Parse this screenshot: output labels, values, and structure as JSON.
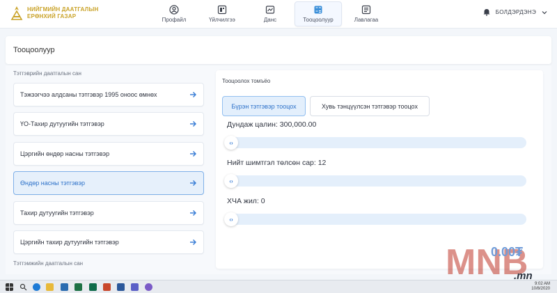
{
  "app": {
    "logo_line1": "НИЙГМИЙН ДААТГАЛЫН",
    "logo_line2": "ЕРӨНХИЙ ГАЗАР",
    "brand_color": "#c9a227",
    "accent_color": "#2e72c9"
  },
  "nav": {
    "items": [
      {
        "label": "Профайл",
        "icon": "user-circle-icon"
      },
      {
        "label": "Үйлчилгээ",
        "icon": "services-icon"
      },
      {
        "label": "Данс",
        "icon": "monitor-icon"
      },
      {
        "label": "Тооцоолуур",
        "icon": "calculator-icon",
        "active": true
      },
      {
        "label": "Лавлагаа",
        "icon": "reference-icon"
      }
    ]
  },
  "user": {
    "name": "БОЛДЭРДЭНЭ",
    "bell_icon": "bell-icon"
  },
  "page": {
    "title": "Тооцоолуур"
  },
  "pension_section": {
    "label": "Тэтгэврийн даатгалын сан",
    "items": [
      {
        "label": "Тэжээгчээ алдсаны тэтгэвэр 1995 оноос өмнөх"
      },
      {
        "label": "ҮО-Тахир дутуугийн тэтгэвэр"
      },
      {
        "label": "Цэргийн өндөр насны тэтгэвэр"
      },
      {
        "label": "Өндөр насны тэтгэвэр",
        "active": true
      },
      {
        "label": "Тахир дутуугийн тэтгэвэр"
      },
      {
        "label": "Цэргийн тахир дутуугийн тэтгэвэр"
      }
    ]
  },
  "benefit_section": {
    "label": "Тэтгэмжийн даатгалын сан"
  },
  "calculator": {
    "title": "Тооцоолох томъёо",
    "tabs": [
      {
        "label": "Бүрэн тэтгэвэр тооцох",
        "active": true
      },
      {
        "label": "Хувь тэнцүүлсэн тэтгэвэр тооцох"
      }
    ],
    "fields": [
      {
        "label": "Дундаж цалин: 300,000.00",
        "value": 0
      },
      {
        "label": "Нийт шимтгэл төлсөн сар: 12",
        "value": 0
      },
      {
        "label": "ХЧА жил: 0",
        "value": 0
      }
    ],
    "result": "0.00₮"
  },
  "watermark": {
    "text": "MNB",
    "site": ".mn"
  },
  "taskbar": {
    "time": "9:02 AM",
    "date": "10/8/2020"
  }
}
